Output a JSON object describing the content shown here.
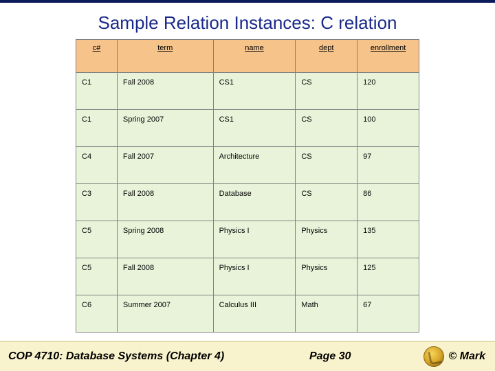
{
  "title": "Sample Relation Instances: C relation",
  "columns": {
    "c": "c#",
    "term": "term",
    "name": "name",
    "dept": "dept",
    "enrollment": "enrollment"
  },
  "rows": [
    {
      "c": "C1",
      "term": "Fall 2008",
      "name": "CS1",
      "dept": "CS",
      "enrollment": "120"
    },
    {
      "c": "C1",
      "term": "Spring 2007",
      "name": "CS1",
      "dept": "CS",
      "enrollment": "100"
    },
    {
      "c": "C4",
      "term": "Fall 2007",
      "name": "Architecture",
      "dept": "CS",
      "enrollment": "97"
    },
    {
      "c": "C3",
      "term": "Fall 2008",
      "name": "Database",
      "dept": "CS",
      "enrollment": "86"
    },
    {
      "c": "C5",
      "term": "Spring 2008",
      "name": "Physics I",
      "dept": "Physics",
      "enrollment": "135"
    },
    {
      "c": "C5",
      "term": "Fall 2008",
      "name": "Physics I",
      "dept": "Physics",
      "enrollment": "125"
    },
    {
      "c": "C6",
      "term": "Summer 2007",
      "name": "Calculus III",
      "dept": "Math",
      "enrollment": "67"
    }
  ],
  "footer": {
    "course": "COP 4710: Database Systems  (Chapter 4)",
    "page": "Page 30",
    "copyright": "© Mark"
  },
  "chart_data": {
    "type": "table",
    "title": "C relation",
    "columns": [
      "c#",
      "term",
      "name",
      "dept",
      "enrollment"
    ],
    "rows": [
      [
        "C1",
        "Fall 2008",
        "CS1",
        "CS",
        120
      ],
      [
        "C1",
        "Spring 2007",
        "CS1",
        "CS",
        100
      ],
      [
        "C4",
        "Fall 2007",
        "Architecture",
        "CS",
        97
      ],
      [
        "C3",
        "Fall 2008",
        "Database",
        "CS",
        86
      ],
      [
        "C5",
        "Spring 2008",
        "Physics I",
        "Physics",
        135
      ],
      [
        "C5",
        "Fall 2008",
        "Physics I",
        "Physics",
        125
      ],
      [
        "C6",
        "Summer 2007",
        "Calculus III",
        "Math",
        67
      ]
    ]
  }
}
